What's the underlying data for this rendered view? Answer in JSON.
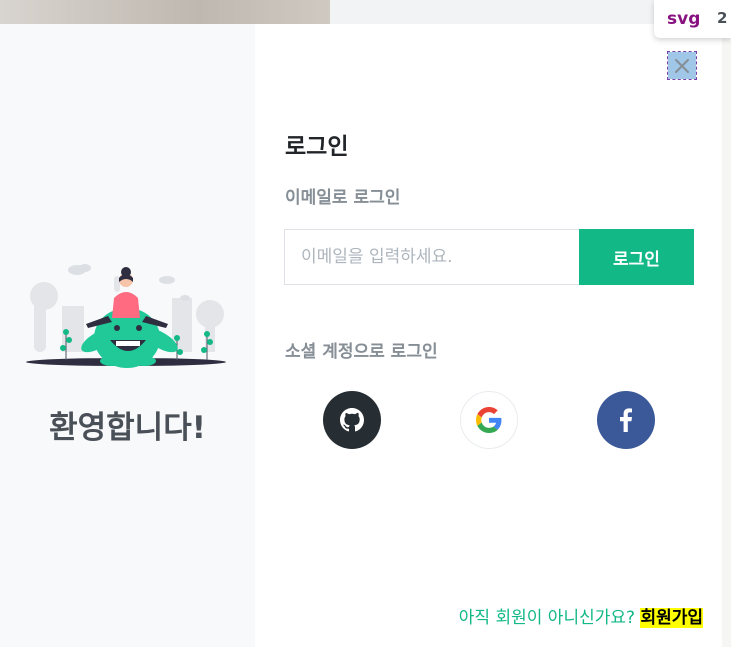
{
  "devtools_tooltip": {
    "tag": "svg",
    "dimension": "2"
  },
  "welcome": {
    "title": "환영합니다!"
  },
  "login": {
    "title": "로그인",
    "email_section_label": "이메일로 로그인",
    "email_placeholder": "이메일을 입력하세요.",
    "email_value": "",
    "submit_label": "로그인",
    "social_section_label": "소셜 계정으로 로그인",
    "social_buttons": [
      "github-icon",
      "google-icon",
      "facebook-icon"
    ]
  },
  "footer": {
    "question": "아직 회원이 아니신가요?",
    "signup_link": "회원가입"
  },
  "colors": {
    "accent": "#12b886",
    "github": "#272e33",
    "facebook": "#3b5998",
    "left_panel": "#f8f9fa",
    "highlight": "#ffff00"
  }
}
